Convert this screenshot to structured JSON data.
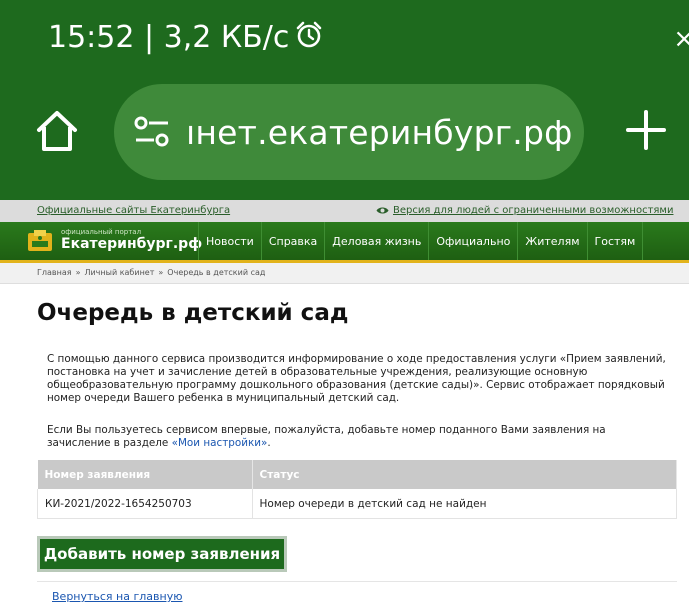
{
  "status_bar": {
    "time_speed": "15:52 | 3,2 КБ/с",
    "alarm_icon": "alarm-clock-icon",
    "close_glyph": "×"
  },
  "browser": {
    "home_icon": "home-icon",
    "tune_icon": "page-settings-icon",
    "url": "ıнет.екатеринбург.рф",
    "new_tab_icon": "plus-icon"
  },
  "topbar": {
    "official_sites": "Официальные сайты Екатеринбурга",
    "accessibility": "Версия для людей с ограниченными возможностями"
  },
  "header": {
    "logo_small": "официальный портал",
    "logo_name": "Екатеринбург.рф",
    "nav": [
      "Новости",
      "Справка",
      "Деловая жизнь",
      "Официально",
      "Жителям",
      "Гостям"
    ]
  },
  "breadcrumb": [
    "Главная",
    "Личный кабинет",
    "Очередь в детский сад"
  ],
  "breadcrumb_sep": "»",
  "main": {
    "title": "Очередь в детский сад",
    "intro": "С помощью данного сервиса производится информирование о ходе предоставления услуги «Прием заявлений, постановка на учет и зачисление детей в образовательные учреждения, реализующие основную общеобразовательную программу дошкольного образования (детские сады)». Сервис отображает порядковый номер очереди Вашего ребенка в муниципальный детский сад.",
    "first_use_text": "Если Вы пользуетесь сервисом впервые, пожалуйста, добавьте номер поданного Вами заявления на зачисление в разделе ",
    "settings_link": "«Мои настройки»",
    "first_use_end": ".",
    "table": {
      "headers": [
        "Номер заявления",
        "Статус"
      ],
      "rows": [
        [
          "КИ-2021/2022-1654250703",
          "Номер очереди в детский сад не найден"
        ]
      ]
    },
    "add_button": "Добавить номер заявления",
    "back_link": "Вернуться на главную"
  },
  "colors": {
    "browser_green": "#1e6a1e",
    "header_green": "#2a7a1c",
    "header_stripe": "#e2b31b",
    "link_blue": "#1a56b0"
  }
}
